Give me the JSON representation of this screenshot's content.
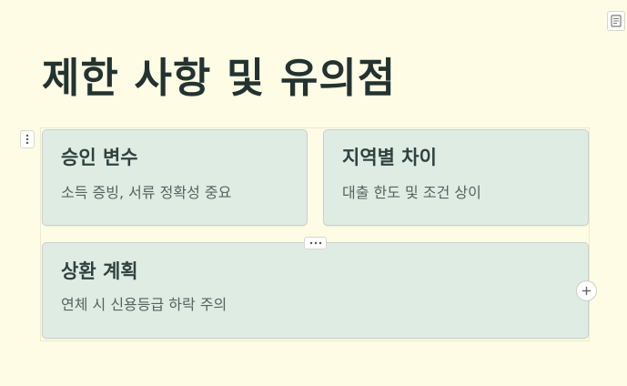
{
  "page": {
    "title": "제한 사항 및 유의점"
  },
  "cards": [
    {
      "title": "승인 변수",
      "description": "소득 증빙, 서류 정확성 중요"
    },
    {
      "title": "지역별 차이",
      "description": "대출 한도 및 조건 상이"
    },
    {
      "title": "상환 계획",
      "description": "연체 시 신용등급 하락 주의"
    }
  ],
  "icons": {
    "notes": "notes-icon",
    "drag_handle": "vertical-dots-icon",
    "row_handle": "horizontal-dots-icon",
    "add": "plus-icon"
  },
  "colors": {
    "page_background": "#fefce5",
    "card_background": "#dfece4",
    "card_border": "#c6d3cb",
    "title_text": "#233331",
    "card_title_text": "#2f4240",
    "card_desc_text": "#55625f"
  }
}
